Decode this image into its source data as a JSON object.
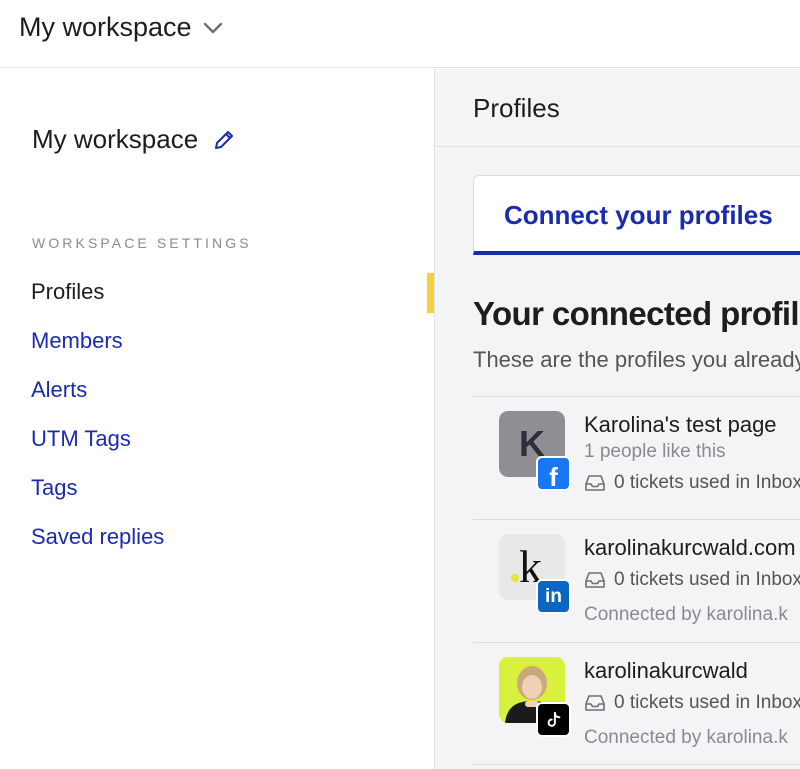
{
  "topbar": {
    "workspace_name": "My workspace"
  },
  "sidebar": {
    "title": "My workspace",
    "section_label": "WORKSPACE SETTINGS",
    "items": [
      {
        "label": "Profiles",
        "active": true
      },
      {
        "label": "Members"
      },
      {
        "label": "Alerts"
      },
      {
        "label": "UTM Tags"
      },
      {
        "label": "Tags"
      },
      {
        "label": "Saved replies"
      }
    ]
  },
  "main": {
    "header": "Profiles",
    "tab_label": "Connect your profiles",
    "connected_title": "Your connected profiles",
    "connected_desc": "These are the profiles you already",
    "profiles": [
      {
        "name": "Karolina's test page",
        "likes": "1 people like this",
        "tickets": "0 tickets used in Inbox",
        "network": "facebook-icon",
        "avatar_letter": "K"
      },
      {
        "name": "karolinakurcwald.com",
        "tickets": "0 tickets used in Inbox",
        "connected_by": "Connected by karolina.k",
        "network": "linkedin-icon",
        "avatar_letter": "k"
      },
      {
        "name": "karolinakurcwald",
        "tickets": "0 tickets used in Inbox",
        "connected_by": "Connected by karolina.k",
        "network": "tiktok-icon"
      }
    ]
  },
  "colors": {
    "accent": "#1a2bb0",
    "active_marker": "#f5d23a",
    "facebook": "#1877f2",
    "linkedin": "#0a66c2",
    "tiktok": "#000000"
  }
}
